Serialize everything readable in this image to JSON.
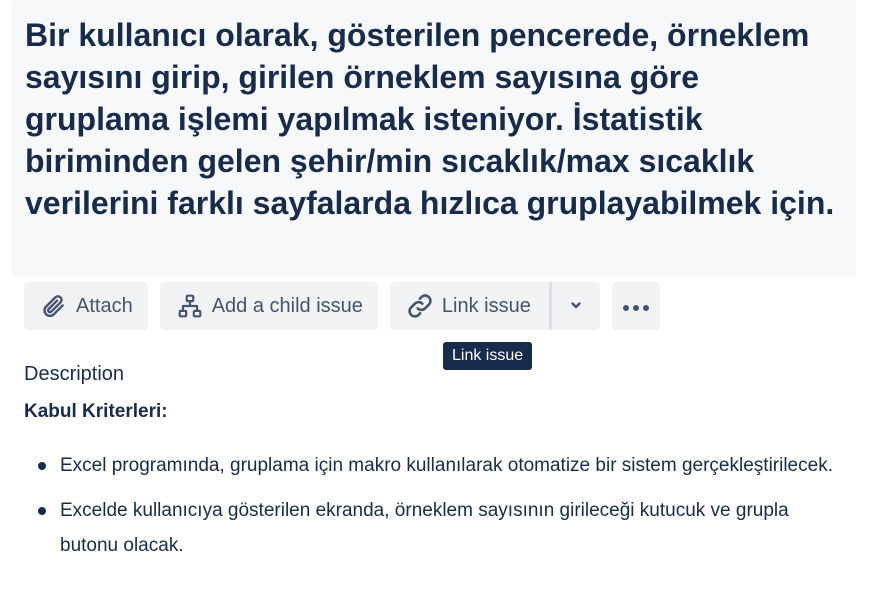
{
  "issue": {
    "title": "Bir kullanıcı olarak, gösterilen pencerede, örneklem sayısını girip, girilen örneklem sayısına göre gruplama işlemi yapılmak isteniyor. İstatistik biriminden gelen şehir/min sıcaklık/max sıcaklık verilerini farklı sayfalarda hızlıca gruplayabilmek için."
  },
  "toolbar": {
    "attach_label": "Attach",
    "attach_icon": "paperclip-icon",
    "child_label": "Add a child issue",
    "child_icon": "hierarchy-icon",
    "link_label": "Link issue",
    "link_icon": "link-icon",
    "dropdown_icon": "chevron-down-icon",
    "more_icon": "more-horizontal-icon"
  },
  "tooltip": {
    "text": "Link issue"
  },
  "description": {
    "label": "Description",
    "criteria_heading": "Kabul Kriterleri:",
    "items": [
      "Excel programında, gruplama için makro kullanılarak otomatize bir sistem gerçekleştirilecek.",
      "Excelde kullanıcıya gösterilen ekranda, örneklem sayısının girileceği kutucuk ve grupla butonu olacak."
    ]
  },
  "colors": {
    "text": "#172b4d",
    "button_bg": "#f1f2f4",
    "button_text": "#44546f",
    "tooltip_bg": "#172b4d",
    "title_bg": "#f7f8f9"
  }
}
